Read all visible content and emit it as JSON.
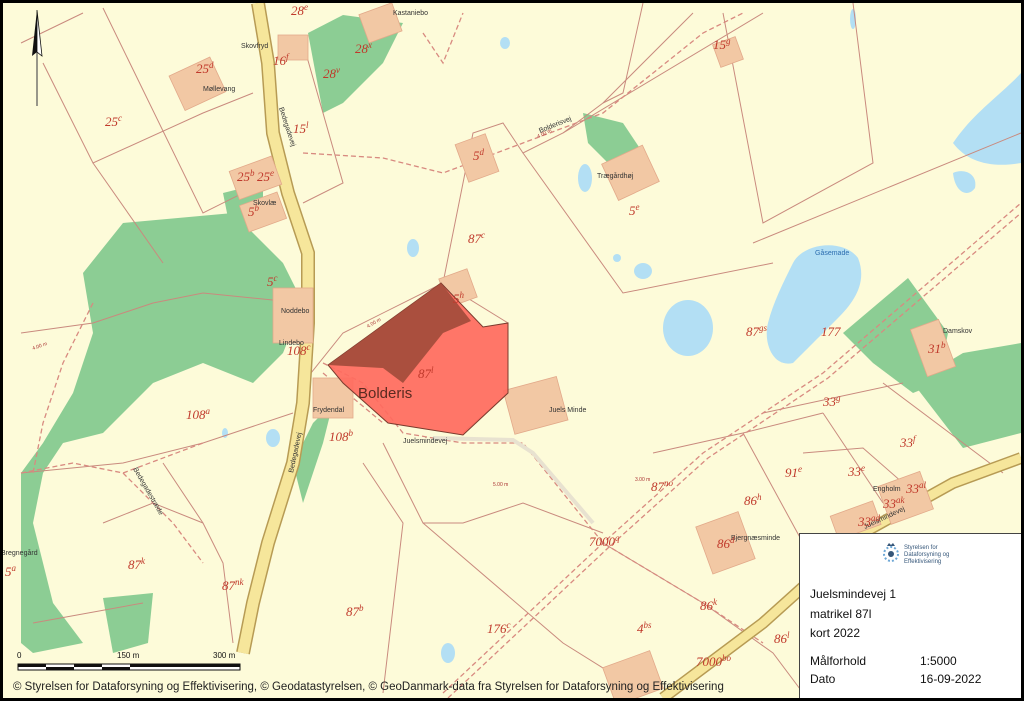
{
  "map": {
    "focus_label": "Bolderis",
    "colors": {
      "background": "#fdfbd9",
      "forest": "#8ccd94",
      "water": "#b3dff4",
      "building": "#f2c8a4",
      "boundary": "#c98a7e",
      "main_road": "#f6e69b",
      "highlight": "#ff6a5e",
      "highlight_dark": "#a14b3a"
    },
    "places": [
      "Kastaniebo",
      "Skovfryd",
      "Møllevang",
      "Trægårdhøj",
      "Noddebo",
      "Lindebo",
      "Frydendal",
      "Juels Minde",
      "Damskov",
      "Engholm",
      "Bjergnæsminde",
      "Skovlæ",
      "Gåsemade",
      "Bregnegård"
    ],
    "roads": [
      "Bedegadevej",
      "Bolderisvej",
      "Juelsmindevej",
      "Bedegadestræde",
      "Juelsmindevej"
    ],
    "parcels": [
      {
        "num": "28",
        "sup": "e"
      },
      {
        "num": "25",
        "sup": "d"
      },
      {
        "num": "16",
        "sup": "f"
      },
      {
        "num": "28",
        "sup": "v"
      },
      {
        "num": "28",
        "sup": "x"
      },
      {
        "num": "15",
        "sup": "g"
      },
      {
        "num": "25",
        "sup": "c"
      },
      {
        "num": "15",
        "sup": "l"
      },
      {
        "num": "5",
        "sup": "d"
      },
      {
        "num": "25",
        "sup": "b"
      },
      {
        "num": "25",
        "sup": "e"
      },
      {
        "num": "5",
        "sup": "b"
      },
      {
        "num": "5",
        "sup": "e"
      },
      {
        "num": "87",
        "sup": "c"
      },
      {
        "num": "5",
        "sup": "c"
      },
      {
        "num": "5",
        "sup": "h"
      },
      {
        "num": "87",
        "sup": "l"
      },
      {
        "num": "108",
        "sup": "c"
      },
      {
        "num": "87",
        "sup": "gs"
      },
      {
        "num": "177",
        "sup": ""
      },
      {
        "num": "31",
        "sup": "b"
      },
      {
        "num": "108",
        "sup": "a"
      },
      {
        "num": "108",
        "sup": "b"
      },
      {
        "num": "33",
        "sup": "g"
      },
      {
        "num": "33",
        "sup": "f"
      },
      {
        "num": "91",
        "sup": "e"
      },
      {
        "num": "33",
        "sup": "e"
      },
      {
        "num": "87",
        "sup": "no"
      },
      {
        "num": "86",
        "sup": "h"
      },
      {
        "num": "33",
        "sup": "al"
      },
      {
        "num": "33",
        "sup": "ak"
      },
      {
        "num": "33",
        "sup": "ad"
      },
      {
        "num": "7000",
        "sup": "q"
      },
      {
        "num": "86",
        "sup": "d"
      },
      {
        "num": "87",
        "sup": "k"
      },
      {
        "num": "5",
        "sup": "a"
      },
      {
        "num": "87",
        "sup": "nk"
      },
      {
        "num": "87",
        "sup": "b"
      },
      {
        "num": "86",
        "sup": "k"
      },
      {
        "num": "176",
        "sup": "c"
      },
      {
        "num": "4",
        "sup": "bs"
      },
      {
        "num": "86",
        "sup": "l"
      },
      {
        "num": "7000",
        "sup": "bo"
      }
    ],
    "distance_labels": [
      "4.00 m",
      "5.00 m",
      "3.00 m"
    ]
  },
  "scalebar": {
    "labels": [
      "0",
      "150 m",
      "300 m"
    ]
  },
  "copyright": "© Styrelsen for Dataforsyning og Effektivisering, © Geodatastyrelsen, © GeoDanmark-data fra Styrelsen for Dataforsyning og Effektivisering",
  "legend": {
    "logo_text_1": "Styrelsen for",
    "logo_text_2": "Dataforsyning og",
    "logo_text_3": "Effektivisering",
    "address": "Juelsmindevej 1",
    "cadastre": "matrikel 87l",
    "map_year": "kort 2022",
    "scale_label": "Målforhold",
    "scale_value": "1:5000",
    "date_label": "Dato",
    "date_value": "16-09-2022"
  }
}
